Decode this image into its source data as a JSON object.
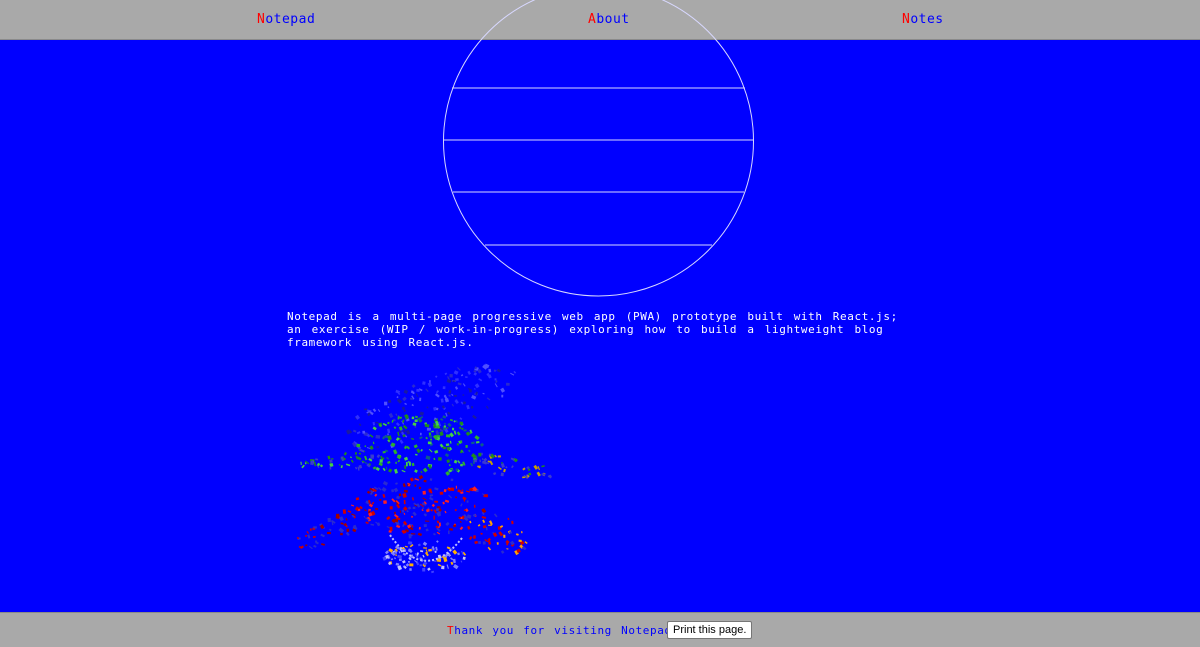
{
  "nav": {
    "items": [
      {
        "first": "N",
        "rest": "otepad"
      },
      {
        "first": "A",
        "rest": "bout"
      },
      {
        "first": "N",
        "rest": "otes"
      }
    ]
  },
  "intro": {
    "text": "Notepad is a multi-page progressive web app (PWA) prototype built with React.js; an exercise (WIP / work-in-progress) exploring how to build a lightweight blog framework using React.js."
  },
  "footer": {
    "text_first": "T",
    "text_rest": "hank you for visiting Notepad.",
    "print_label": "Print this page."
  },
  "colors": {
    "background": "#0000ff",
    "bars": "#a9a9a9",
    "accent_first_letter": "#ff0000",
    "link": "#0000ff"
  }
}
